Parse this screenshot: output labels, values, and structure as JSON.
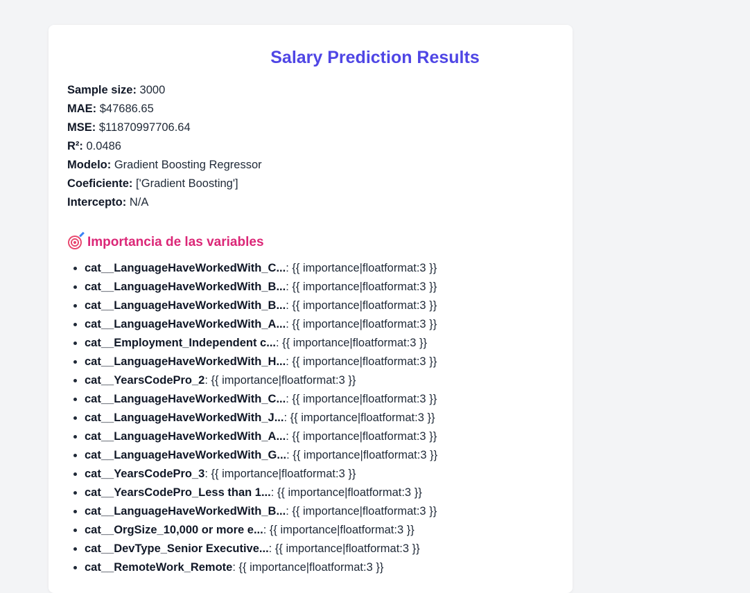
{
  "title": "Salary Prediction Results",
  "stats": [
    {
      "label": "Sample size:",
      "value": " 3000"
    },
    {
      "label": "MAE:",
      "value": " $47686.65"
    },
    {
      "label": "MSE:",
      "value": " $11870997706.64"
    },
    {
      "label": "R²:",
      "value": " 0.0486"
    },
    {
      "label": "Modelo:",
      "value": " Gradient Boosting Regressor"
    },
    {
      "label": "Coeficiente:",
      "value": " ['Gradient Boosting']"
    },
    {
      "label": "Intercepto:",
      "value": " N/A"
    }
  ],
  "importance": {
    "icon": "target-icon",
    "heading": "Importancia de las variables",
    "value_template": ": {{ importance|floatformat:3 }}",
    "items": [
      "cat__LanguageHaveWorkedWith_C...",
      "cat__LanguageHaveWorkedWith_B...",
      "cat__LanguageHaveWorkedWith_B...",
      "cat__LanguageHaveWorkedWith_A...",
      "cat__Employment_Independent c...",
      "cat__LanguageHaveWorkedWith_H...",
      "cat__YearsCodePro_2",
      "cat__LanguageHaveWorkedWith_C...",
      "cat__LanguageHaveWorkedWith_J...",
      "cat__LanguageHaveWorkedWith_A...",
      "cat__LanguageHaveWorkedWith_G...",
      "cat__YearsCodePro_3",
      "cat__YearsCodePro_Less than 1...",
      "cat__LanguageHaveWorkedWith_B...",
      "cat__OrgSize_10,000 or more e...",
      "cat__DevType_Senior Executive...",
      "cat__RemoteWork_Remote"
    ]
  }
}
